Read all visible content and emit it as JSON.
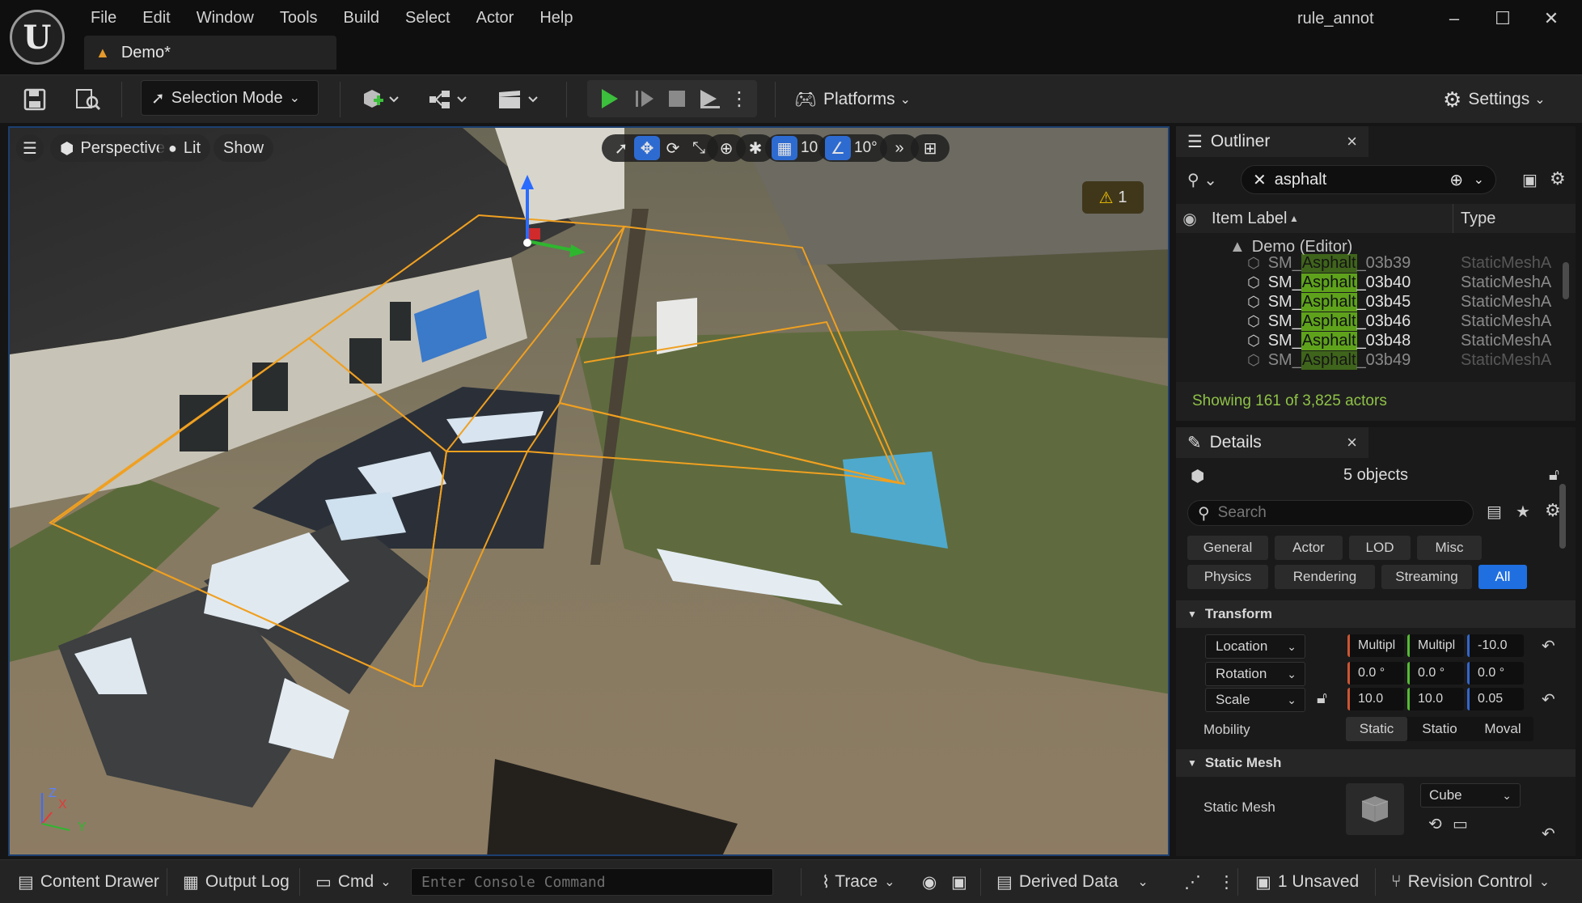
{
  "window": {
    "logo": "U",
    "project_name": "rule_annot",
    "level_tab": "Demo*",
    "minimize": "–",
    "maximize": "☐",
    "close": "✕"
  },
  "menu": [
    "File",
    "Edit",
    "Window",
    "Tools",
    "Build",
    "Select",
    "Actor",
    "Help"
  ],
  "toolbar": {
    "selection_mode": "Selection Mode",
    "platforms": "Platforms",
    "settings": "Settings"
  },
  "viewport": {
    "perspective": "Perspective",
    "lit": "Lit",
    "show": "Show",
    "grid_snap": "10",
    "rotation_snap": "10°",
    "warning_count": "1",
    "axis_z": "Z",
    "axis_x": "X",
    "axis_y": "Y"
  },
  "outliner": {
    "title": "Outliner",
    "search_value": "asphalt",
    "col_label": "Item Label",
    "col_type": "Type",
    "root": "Demo (Editor)",
    "rows": [
      {
        "pre": "SM_",
        "hl": "Asphalt",
        "post": "_03b39",
        "type": "StaticMeshA"
      },
      {
        "pre": "SM_",
        "hl": "Asphalt",
        "post": "_03b40",
        "type": "StaticMeshA"
      },
      {
        "pre": "SM_",
        "hl": "Asphalt",
        "post": "_03b45",
        "type": "StaticMeshA"
      },
      {
        "pre": "SM_",
        "hl": "Asphalt",
        "post": "_03b46",
        "type": "StaticMeshA"
      },
      {
        "pre": "SM_",
        "hl": "Asphalt",
        "post": "_03b48",
        "type": "StaticMeshA"
      },
      {
        "pre": "SM_",
        "hl": "Asphalt",
        "post": "_03b49",
        "type": "StaticMeshA"
      }
    ],
    "footer": "Showing 161 of 3,825 actors"
  },
  "details": {
    "title": "Details",
    "selection": "5 objects",
    "search_placeholder": "Search",
    "filters_row1": [
      "General",
      "Actor",
      "LOD",
      "Misc"
    ],
    "filters_row2": [
      "Physics",
      "Rendering",
      "Streaming",
      "All"
    ],
    "transform": {
      "header": "Transform",
      "location_label": "Location",
      "location": [
        "Multipl",
        "Multipl",
        "-10.0"
      ],
      "rotation_label": "Rotation",
      "rotation": [
        "0.0 °",
        "0.0 °",
        "0.0 °"
      ],
      "scale_label": "Scale",
      "scale": [
        "10.0",
        "10.0",
        "0.05"
      ],
      "mobility_label": "Mobility",
      "mobility": [
        "Static",
        "Statio",
        "Moval"
      ]
    },
    "static_mesh": {
      "header": "Static Mesh",
      "label": "Static Mesh",
      "value": "Cube"
    }
  },
  "statusbar": {
    "content_drawer": "Content Drawer",
    "output_log": "Output Log",
    "cmd": "Cmd",
    "cmd_placeholder": "Enter Console Command",
    "trace": "Trace",
    "derived_data": "Derived Data",
    "unsaved": "1 Unsaved",
    "revision_control": "Revision Control"
  },
  "colors": {
    "accent": "#1f6fe0",
    "highlight": "#5ea21c",
    "selection_outline": "#f0a020",
    "play_green": "#3cbf3c"
  }
}
